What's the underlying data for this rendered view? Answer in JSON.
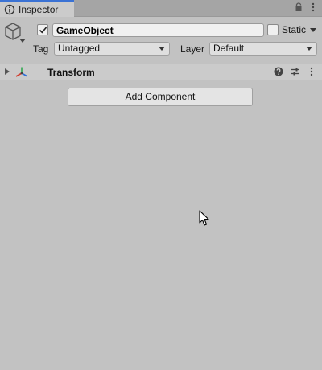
{
  "tab": {
    "label": "Inspector"
  },
  "header": {
    "object_name": "GameObject",
    "active": true,
    "static_label": "Static",
    "static_checked": false,
    "tag_label": "Tag",
    "tag_value": "Untagged",
    "layer_label": "Layer",
    "layer_value": "Default"
  },
  "component": {
    "title": "Transform",
    "expanded": false
  },
  "add_component_label": "Add Component",
  "icons": {
    "tab": "inspector-icon",
    "lock": "lock-icon",
    "menu": "kebab-menu-icon",
    "gameobject": "cube-icon",
    "transform": "transform-axes-icon",
    "help": "help-icon",
    "presets": "presets-icon"
  },
  "colors": {
    "accent": "#3a72d4",
    "background": "#c2c2c2"
  }
}
